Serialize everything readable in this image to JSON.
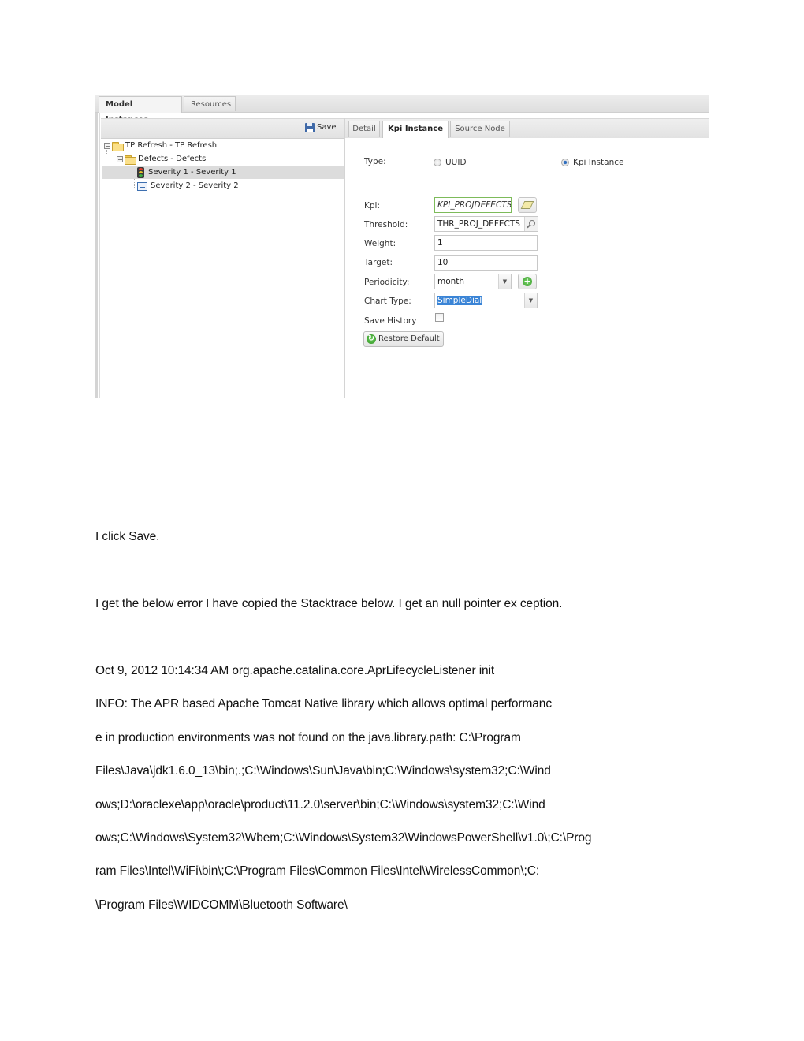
{
  "screenshot": {
    "outer_tabs": [
      {
        "label": "Model Instances",
        "active": true
      },
      {
        "label": "Resources",
        "active": false
      }
    ],
    "toolbar": {
      "save_label": "Save"
    },
    "tree": [
      {
        "label": "TP Refresh - TP Refresh",
        "icon": "folder-icon",
        "level": 0,
        "expanded": true
      },
      {
        "label": "Defects - Defects",
        "icon": "folder-icon",
        "level": 1,
        "expanded": true
      },
      {
        "label": "Severity 1 - Severity 1",
        "icon": "traffic-light-icon",
        "level": 2,
        "selected": true
      },
      {
        "label": "Severity 2 - Severity 2",
        "icon": "list-icon",
        "level": 2,
        "selected": false
      }
    ],
    "detail_tabs": [
      {
        "label": "Detail",
        "active": false
      },
      {
        "label": "Kpi Instance",
        "active": true
      },
      {
        "label": "Source Node",
        "active": false
      }
    ],
    "form": {
      "type_label": "Type:",
      "type_options": [
        {
          "label": "UUID",
          "selected": false
        },
        {
          "label": "Kpi Instance",
          "selected": true
        }
      ],
      "kpi_label": "Kpi:",
      "kpi_value": "KPI_PROJDEFECTS",
      "threshold_label": "Threshold:",
      "threshold_value": "THR_PROJ_DEFECTS",
      "weight_label": "Weight:",
      "weight_value": "1",
      "target_label": "Target:",
      "target_value": "10",
      "periodicity_label": "Periodicity:",
      "periodicity_value": "month",
      "chart_type_label": "Chart Type:",
      "chart_type_value": "SimpleDial",
      "save_history_label": "Save History",
      "save_history_checked": false,
      "restore_default_label": "Restore Default"
    }
  },
  "document": {
    "lines": [
      "I click Save.",
      "I get the below error I have copied the Stacktrace below. I get an null pointer ex ception.",
      "Oct 9, 2012 10:14:34 AM org.apache.catalina.core.AprLifecycleListener init",
      "INFO: The APR based Apache Tomcat Native library which allows optimal performanc",
      "e in production environments was not found on the java.library.path: C:\\Program",
      "Files\\Java\\jdk1.6.0_13\\bin;.;C:\\Windows\\Sun\\Java\\bin;C:\\Windows\\system32;C:\\Wind",
      "ows;D:\\oraclexe\\app\\oracle\\product\\11.2.0\\server\\bin;C:\\Windows\\system32;C:\\Wind",
      "ows;C:\\Windows\\System32\\Wbem;C:\\Windows\\System32\\WindowsPowerShell\\v1.0\\;C:\\Prog",
      "ram Files\\Intel\\WiFi\\bin\\;C:\\Program Files\\Common Files\\Intel\\WirelessCommon\\;C:",
      "\\Program Files\\WIDCOMM\\Bluetooth Software\\"
    ]
  }
}
